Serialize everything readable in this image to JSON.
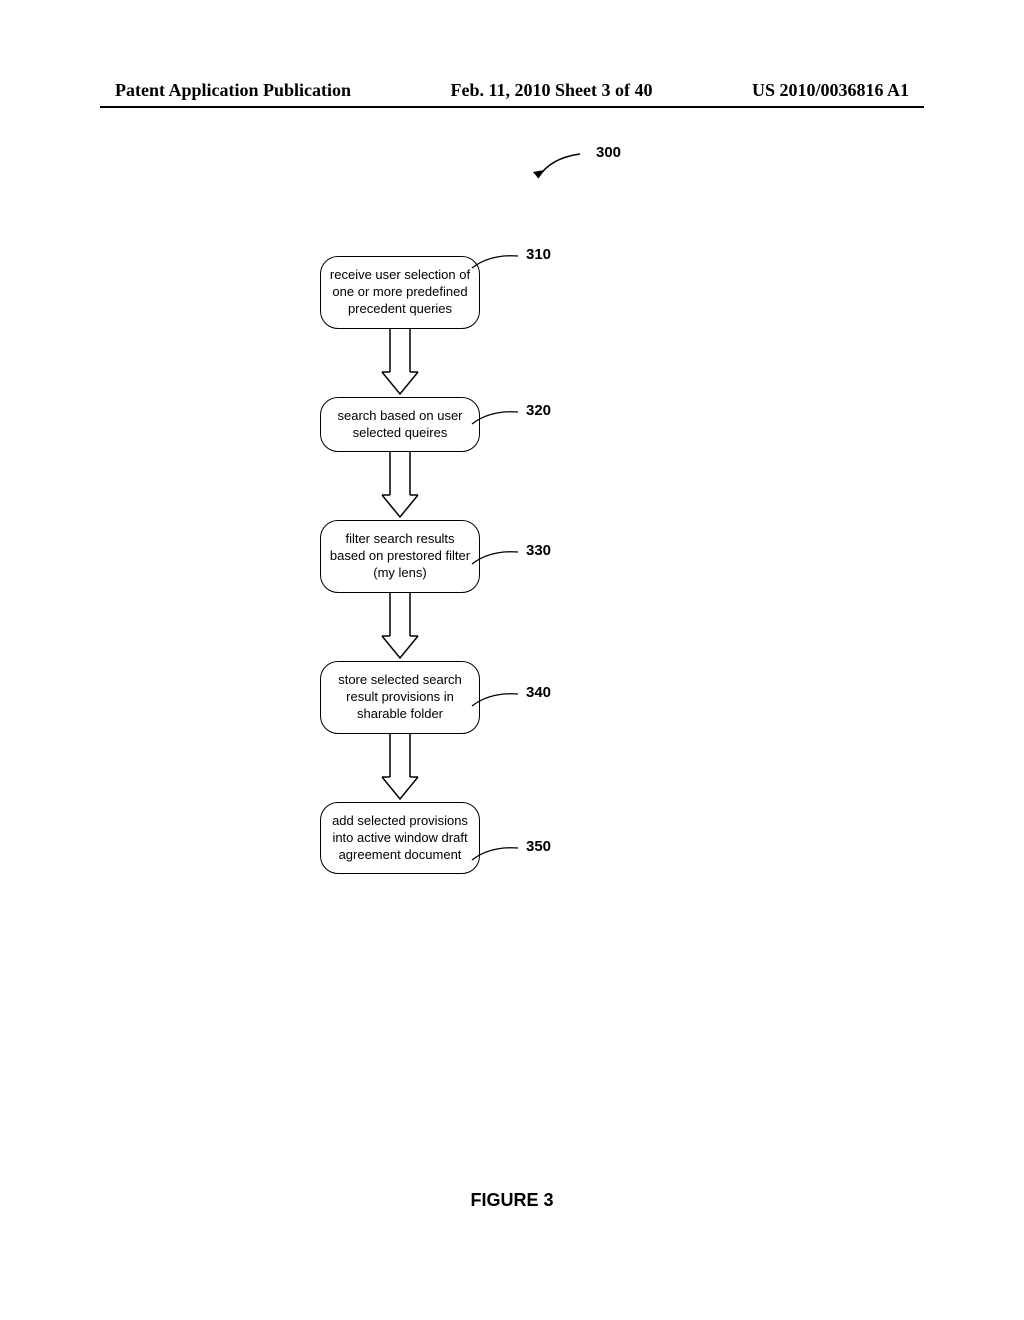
{
  "header": {
    "left": "Patent Application Publication",
    "center": "Feb. 11, 2010  Sheet 3 of 40",
    "right": "US 2010/0036816 A1"
  },
  "fig_ref": "300",
  "steps": [
    {
      "ref": "310",
      "text": "receive user selection of one or more predefined precedent queries"
    },
    {
      "ref": "320",
      "text": "search based on user selected queires"
    },
    {
      "ref": "330",
      "text": "filter search results based on prestored filter (my lens)"
    },
    {
      "ref": "340",
      "text": "store selected search result provisions in sharable folder"
    },
    {
      "ref": "350",
      "text": "add selected provisions into active window draft agreement document"
    }
  ],
  "caption": "FIGURE 3"
}
